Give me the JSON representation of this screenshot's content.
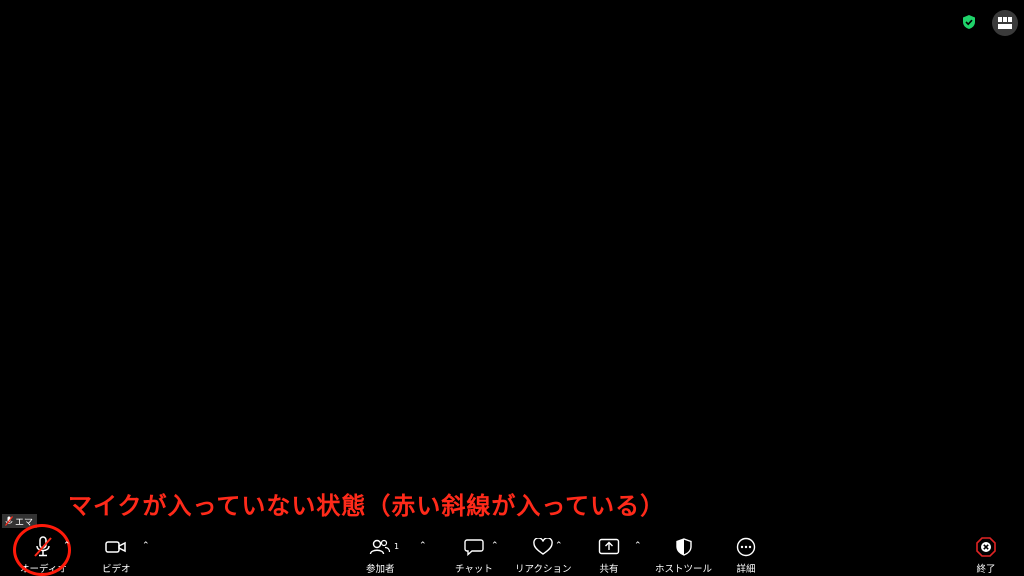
{
  "annotation": {
    "text": "マイクが入っていない状態（赤い斜線が入っている）"
  },
  "participant": {
    "name": "エマ"
  },
  "toolbar": {
    "audio_label": "オーディオ",
    "video_label": "ビデオ",
    "participants_label": "参加者",
    "participants_count": "1",
    "chat_label": "チャット",
    "reactions_label": "リアクション",
    "share_label": "共有",
    "host_tools_label": "ホストツール",
    "more_label": "詳細",
    "end_label": "終了"
  },
  "colors": {
    "accent_red": "#ff1a0a",
    "shield_green": "#1fd36a",
    "end_red": "#e02424"
  },
  "icons": [
    "shield-check-icon",
    "grid-view-icon",
    "mic-muted-icon",
    "video-camera-icon",
    "participants-icon",
    "chat-bubble-icon",
    "heart-icon",
    "share-upload-icon",
    "host-shield-icon",
    "more-dots-icon",
    "end-x-icon"
  ]
}
